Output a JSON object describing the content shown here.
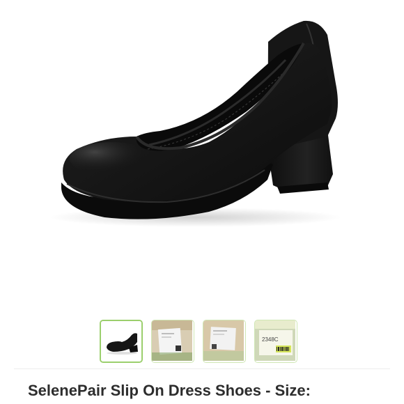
{
  "product": {
    "title": "SelenePair Slip On Dress Shoes - Size:"
  },
  "gallery": {
    "selected_index": 0,
    "thumbnails": [
      {
        "label": "",
        "icon": "shoe-thumbnail-icon"
      },
      {
        "label": "",
        "icon": "insole-tag-thumbnail-icon"
      },
      {
        "label": "",
        "icon": "insole-tag-thumbnail-icon"
      },
      {
        "label": "2348C",
        "icon": "label-barcode-thumbnail-icon"
      }
    ]
  },
  "colors": {
    "thumbnail_border": "#cfe7b4",
    "thumbnail_border_selected": "#9bcf6d",
    "title_text": "#2d2d2d",
    "shoe": "#151515"
  }
}
